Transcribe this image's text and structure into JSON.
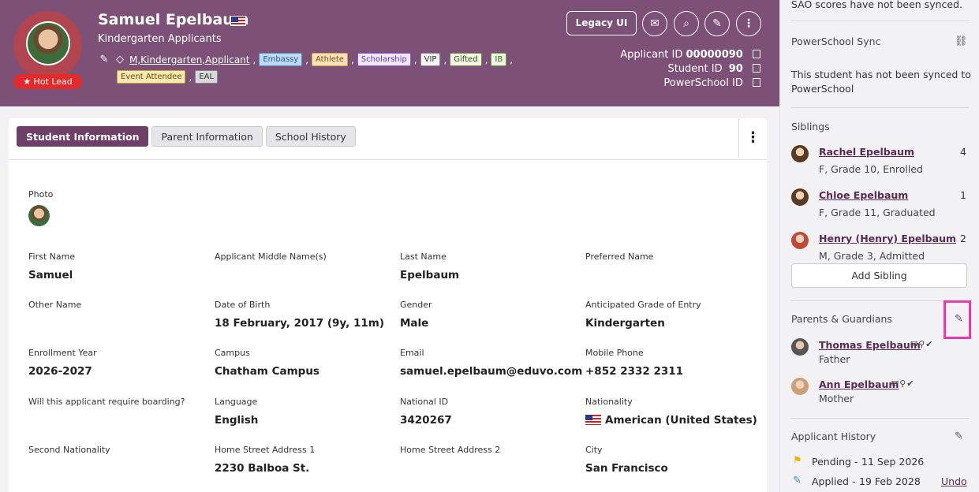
{
  "header": {
    "name": "Samuel Epelbaum",
    "subtitle": "Kindergarten Applicants",
    "hot_lead": "★ Hot Lead",
    "tags_prefix": "M,Kindergarten,Applicant",
    "tags_row1": [
      "Embassy",
      "Athlete",
      "Scholarship",
      "VIP",
      "Gifted",
      "IB"
    ],
    "tags_row2": [
      "Event Attendee",
      "EAL"
    ],
    "legacy_button": "Legacy UI",
    "ids": [
      {
        "label": "Applicant ID",
        "value": "00000090"
      },
      {
        "label": "Student ID",
        "value": "90"
      },
      {
        "label": "PowerSchool ID",
        "value": ""
      }
    ]
  },
  "tabs": [
    "Student Information",
    "Parent Information",
    "School History"
  ],
  "photo_label": "Photo",
  "fields": [
    {
      "label": "First Name",
      "value": "Samuel"
    },
    {
      "label": "Applicant Middle Name(s)",
      "value": ""
    },
    {
      "label": "Last Name",
      "value": "Epelbaum"
    },
    {
      "label": "Preferred Name",
      "value": ""
    },
    {
      "label": "Other Name",
      "value": ""
    },
    {
      "label": "Date of Birth",
      "value": "18 February, 2017 (9y, 11m)"
    },
    {
      "label": "Gender",
      "value": "Male"
    },
    {
      "label": "Anticipated Grade of Entry",
      "value": "Kindergarten"
    },
    {
      "label": "Enrollment Year",
      "value": "2026-2027"
    },
    {
      "label": "Campus",
      "value": "Chatham Campus"
    },
    {
      "label": "Email",
      "value": "samuel.epelbaum@eduvo.com"
    },
    {
      "label": "Mobile Phone",
      "value": "+852 2332 2311"
    },
    {
      "label": "Will this applicant require boarding?",
      "value": ""
    },
    {
      "label": "Language",
      "value": "English"
    },
    {
      "label": "National ID",
      "value": "3420267"
    },
    {
      "label": "Nationality",
      "value": "American (United States)"
    },
    {
      "label": "Second Nationality",
      "value": ""
    },
    {
      "label": "Home Street Address 1",
      "value": "2230 Balboa St."
    },
    {
      "label": "Home Street Address 2",
      "value": ""
    },
    {
      "label": "City",
      "value": "San Francisco"
    }
  ],
  "sidebar": {
    "sao_text": "SAO scores have not been synced.",
    "powerschool_title": "PowerSchool Sync",
    "powerschool_text_1": "This student has not been synced to",
    "powerschool_text_2": "PowerSchool",
    "siblings_title": "Siblings",
    "siblings": [
      {
        "name": "Rachel Epelbaum",
        "sub": "F, Grade 10, Enrolled",
        "count": "4"
      },
      {
        "name": "Chloe Epelbaum",
        "sub": "F, Grade 11, Graduated",
        "count": "1"
      },
      {
        "name": "Henry (Henry) Epelbaum",
        "sub": "M, Grade 3, Admitted",
        "count": "2"
      }
    ],
    "add_sibling": "Add Sibling",
    "parents_title": "Parents & Guardians",
    "parents": [
      {
        "name": "Thomas Epelbaum",
        "relation": "Father"
      },
      {
        "name": "Ann Epelbaum",
        "relation": "Mother"
      }
    ],
    "history_title": "Applicant History",
    "history": [
      {
        "status": "Pending -",
        "date": "11 Sep 2026"
      },
      {
        "status": "Applied -",
        "date": "19 Feb 2028"
      }
    ],
    "undo": "Undo"
  }
}
